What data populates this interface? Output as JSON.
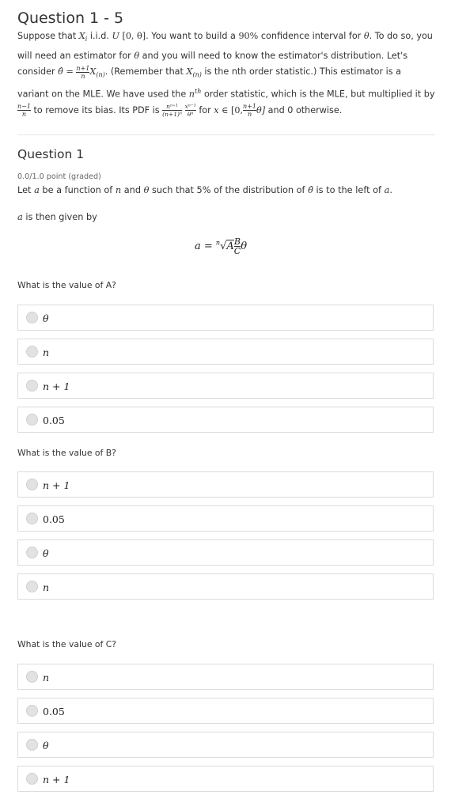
{
  "header": {
    "title": "Question 1 - 5"
  },
  "intro": {
    "suppose": "Suppose that",
    "xi": "X",
    "xi_sub": "i",
    "iid": "i.i.d.",
    "dist": "U",
    "interval": "[0, θ].",
    "want": "You want to build a",
    "conf": "90%",
    "conf_rest": "confidence interval for",
    "theta": "θ",
    "todo": ". To do so,",
    "line2": "you will need an estimator for",
    "line2b": "and you will need to know the estimator's distribution. Let's",
    "consider": "consider",
    "thetahat": "θ̂",
    "eq": "=",
    "frac_num": "n+1",
    "frac_den": "n",
    "xn": "X",
    "xn_sub": "(n)",
    "remember": ". (Remember that",
    "xn2_sub": "(n)",
    "nth": "is the nth order statistic.) This estimator is a",
    "line4a": "variant on the MLE. We have used the",
    "n_sup": "n",
    "th": "th",
    "line4b": "order statistic, which is the MLE, but multiplied it",
    "by": "by",
    "by_num": "n−1",
    "by_den": "n",
    "remove": "to remove its bias. Its PDF is",
    "pdf_num1": "nⁿ⁺¹",
    "pdf_den1": "(n+1)ⁿ",
    "pdf_num2": "xⁿ⁻¹",
    "pdf_den2": "θⁿ",
    "for": "for",
    "x": "x",
    "in": "∈",
    "range": "[0,",
    "r_num": "n+1",
    "r_den": "n",
    "range_end": "θ]",
    "otherwise": "and 0 otherwise."
  },
  "question": {
    "title": "Question 1",
    "meta": "0.0/1.0 point (graded)",
    "stem_pre": "Let",
    "a": "a",
    "stem_mid": "be a function of",
    "n": "n",
    "and": "and",
    "stem_post": "such that 5% of the distribution of",
    "stem_end": "is to the left of",
    "a_given": "is then given by",
    "formula": {
      "lhs": "a =",
      "root_index": "n",
      "radical": "√",
      "A": "A",
      "B": "B",
      "C": "C",
      "theta": "θ"
    }
  },
  "subquestions": [
    {
      "prompt": "What is the value of A?",
      "options": [
        "θ",
        "n",
        "n + 1",
        "0.05"
      ]
    },
    {
      "prompt": "What is the value of B?",
      "options": [
        "n + 1",
        "0.05",
        "θ",
        "n"
      ]
    },
    {
      "prompt": "What is the value of C?",
      "options": [
        "n",
        "0.05",
        "θ",
        "n + 1"
      ]
    }
  ]
}
